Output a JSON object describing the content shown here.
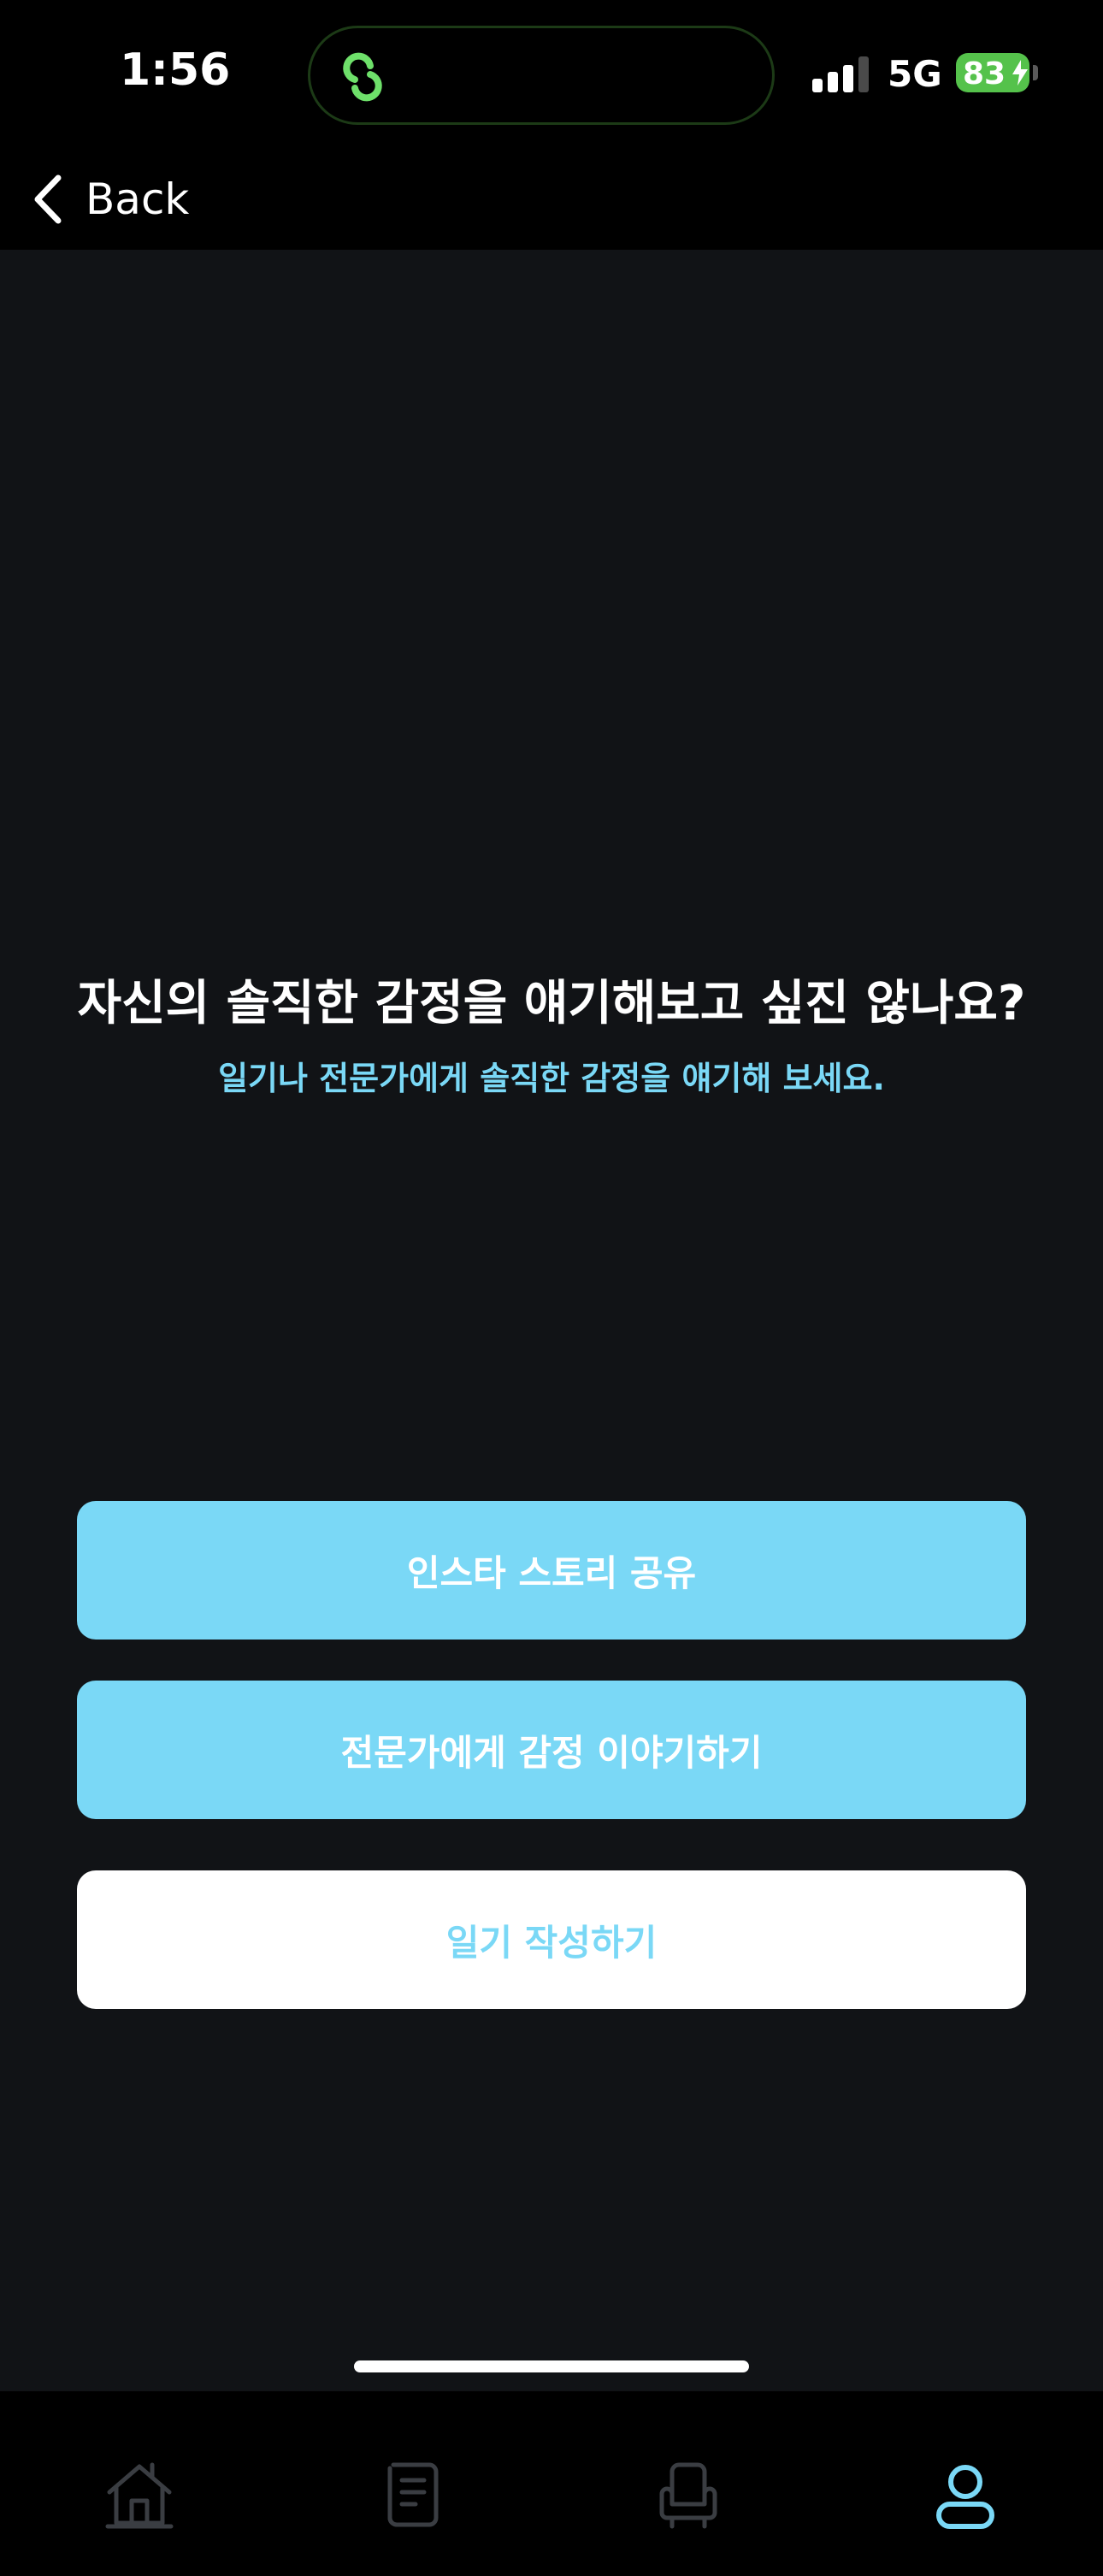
{
  "status_bar": {
    "time": "1:56",
    "network": "5G",
    "battery": "83",
    "island_icon": "link-icon"
  },
  "nav": {
    "back_label": "Back",
    "back_icon": "chevron-left-icon"
  },
  "main": {
    "headline": "자신의 솔직한 감정을 얘기해보고 싶진 않나요?",
    "subline": "일기나 전문가에게 솔직한 감정을 얘기해 보세요."
  },
  "actions": {
    "instagram_story_label": "인스타 스토리 공유",
    "talk_to_expert_label": "전문가에게 감정 이야기하기",
    "write_diary_label": "일기 작성하기"
  },
  "tab_bar": {
    "items": [
      {
        "icon": "home-icon",
        "active": false
      },
      {
        "icon": "diary-icon",
        "active": false
      },
      {
        "icon": "counsel-chair-icon",
        "active": false
      },
      {
        "icon": "profile-icon",
        "active": true
      }
    ]
  },
  "colors": {
    "accent": "#7ad8f6",
    "background": "#111316",
    "bar_background": "#000000",
    "battery": "#55c24b",
    "island_glow": "#6ee06a",
    "inactive_icon": "#3a3d42"
  }
}
